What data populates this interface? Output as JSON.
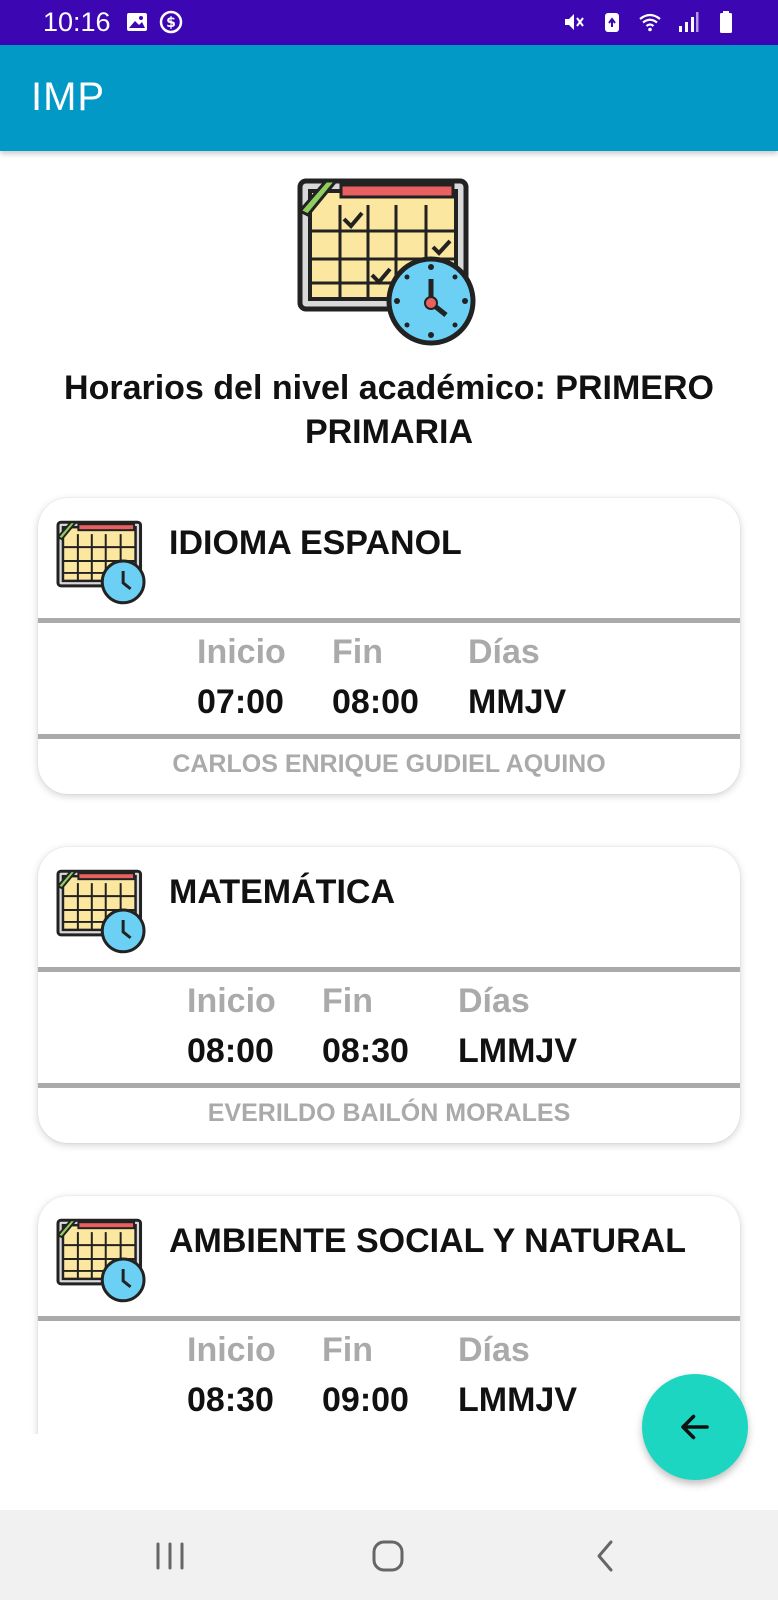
{
  "status_bar": {
    "time": "10:16",
    "left_icons": [
      "image-icon",
      "dollar-circle-icon"
    ],
    "right_icons": [
      "mute-icon",
      "battery-saver-icon",
      "wifi-icon",
      "signal-icon",
      "battery-icon"
    ]
  },
  "app_bar": {
    "title": "IMP",
    "color": "#0399c7"
  },
  "header": {
    "icon": "calendar-clock-icon",
    "title": "Horarios del nivel académico: PRIMERO PRIMARIA"
  },
  "schedule": [
    {
      "subject": "IDIOMA ESPANOL",
      "start_label": "Inicio",
      "end_label": "Fin",
      "days_label": "Días",
      "start": "07:00",
      "end": "08:00",
      "days": "MMJV",
      "teacher": "CARLOS ENRIQUE GUDIEL AQUINO"
    },
    {
      "subject": "MATEMÁTICA",
      "start_label": "Inicio",
      "end_label": "Fin",
      "days_label": "Días",
      "start": "08:00",
      "end": "08:30",
      "days": "LMMJV",
      "teacher": "EVERILDO BAILÓN MORALES"
    },
    {
      "subject": "AMBIENTE SOCIAL Y NATURAL",
      "start_label": "Inicio",
      "end_label": "Fin",
      "days_label": "Días",
      "start": "08:30",
      "end": "09:00",
      "days": "LMMJV",
      "teacher": ""
    }
  ],
  "fab": {
    "icon": "arrow-back-icon",
    "color": "#1dd6c2"
  },
  "nav_bar": {
    "icons": [
      "recent-apps-icon",
      "home-icon",
      "back-icon"
    ]
  }
}
